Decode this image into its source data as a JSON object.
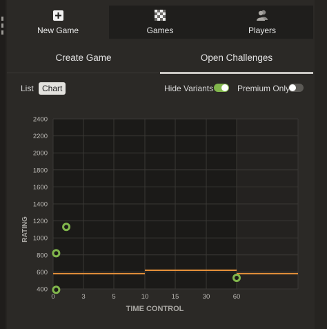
{
  "nav": {
    "tabs": [
      {
        "label": "New Game",
        "icon": "plus-square-icon",
        "active": true
      },
      {
        "label": "Games",
        "icon": "checkerboard-icon",
        "active": false
      },
      {
        "label": "Players",
        "icon": "players-icon",
        "active": false
      }
    ]
  },
  "subtabs": {
    "create": "Create Game",
    "open": "Open Challenges"
  },
  "controls": {
    "list_label": "List",
    "chart_label": "Chart",
    "hide_variants_label": "Hide Variants",
    "hide_variants_on": true,
    "premium_only_label": "Premium Only",
    "premium_only_on": false
  },
  "colors": {
    "accent_green": "#81b64c",
    "line_orange": "#e5903a",
    "background": "#262421"
  },
  "chart_data": {
    "type": "scatter",
    "xlabel": "TIME CONTROL",
    "ylabel": "RATING",
    "x_tick_labels": [
      "0",
      "3",
      "5",
      "10",
      "15",
      "30",
      "60"
    ],
    "y_tick_labels": [
      "400",
      "600",
      "800",
      "1000",
      "1200",
      "1400",
      "1600",
      "1800",
      "2000",
      "2200",
      "2400"
    ],
    "ylim": [
      400,
      2400
    ],
    "points": [
      {
        "x": 0.3,
        "y": 390
      },
      {
        "x": 0.3,
        "y": 820
      },
      {
        "x": 1.3,
        "y": 1130
      },
      {
        "x": 60,
        "y": 530
      }
    ],
    "rating_line": [
      {
        "x_start": "0",
        "x_end": "10",
        "y": 580
      },
      {
        "x_start": "10",
        "x_end": "60",
        "y": 620
      },
      {
        "x_start": "60",
        "x_end": "end",
        "y": 580
      }
    ]
  }
}
